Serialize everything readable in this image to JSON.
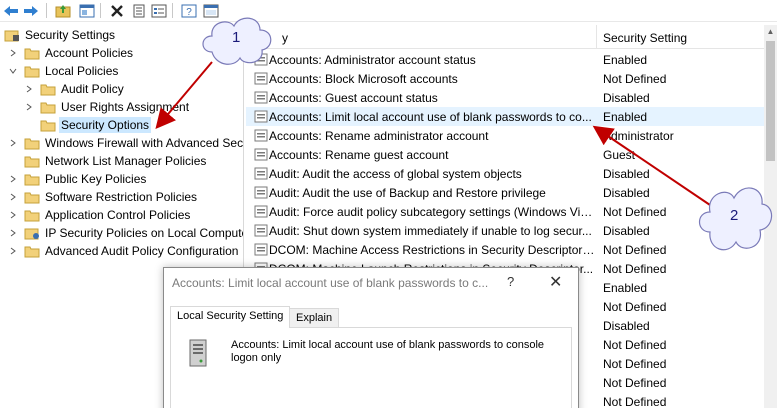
{
  "toolbar": {
    "buttons": [
      "back-icon",
      "forward-icon",
      "folder-up-icon",
      "properties-icon",
      "delete-icon",
      "export-icon",
      "list-icon",
      "help-icon",
      "console-icon"
    ]
  },
  "tree": {
    "root": "Security Settings",
    "items": [
      {
        "label": "Account Policies",
        "level": 1,
        "expanded": false
      },
      {
        "label": "Local Policies",
        "level": 1,
        "expanded": true
      },
      {
        "label": "Audit Policy",
        "level": 2
      },
      {
        "label": "User Rights Assignment",
        "level": 2
      },
      {
        "label": "Security Options",
        "level": 2,
        "selected": true
      },
      {
        "label": "Windows Firewall with Advanced Secu",
        "level": 1
      },
      {
        "label": "Network List Manager Policies",
        "level": 1
      },
      {
        "label": "Public Key Policies",
        "level": 1
      },
      {
        "label": "Software Restriction Policies",
        "level": 1
      },
      {
        "label": "Application Control Policies",
        "level": 1
      },
      {
        "label": "IP Security Policies on Local Compute",
        "level": 1
      },
      {
        "label": "Advanced Audit Policy Configuration",
        "level": 1
      }
    ]
  },
  "list": {
    "col_policy": "y",
    "col_setting": "Security Setting",
    "rows": [
      {
        "policy": "Accounts: Administrator account status",
        "setting": "Enabled"
      },
      {
        "policy": "Accounts: Block Microsoft accounts",
        "setting": "Not Defined"
      },
      {
        "policy": "Accounts: Guest account status",
        "setting": "Disabled"
      },
      {
        "policy": "Accounts: Limit local account use of blank passwords to co...",
        "setting": "Enabled",
        "highlighted": true
      },
      {
        "policy": "Accounts: Rename administrator account",
        "setting": "Administrator"
      },
      {
        "policy": "Accounts: Rename guest account",
        "setting": "Guest"
      },
      {
        "policy": "Audit: Audit the access of global system objects",
        "setting": "Disabled"
      },
      {
        "policy": "Audit: Audit the use of Backup and Restore privilege",
        "setting": "Disabled"
      },
      {
        "policy": "Audit: Force audit policy subcategory settings (Windows Vis...",
        "setting": "Not Defined"
      },
      {
        "policy": "Audit: Shut down system immediately if unable to log secur...",
        "setting": "Disabled"
      },
      {
        "policy": "DCOM: Machine Access Restrictions in Security Descriptor D...",
        "setting": "Not Defined"
      },
      {
        "policy": "DCOM: Machine Launch Restrictions in Security Descriptor...",
        "setting": "Not Defined"
      },
      {
        "policy": "",
        "setting": "Enabled"
      },
      {
        "policy": "",
        "setting": "Not Defined"
      },
      {
        "policy": "",
        "setting": "Disabled"
      },
      {
        "policy": "",
        "setting": "Not Defined"
      },
      {
        "policy": "",
        "setting": "Not Defined"
      },
      {
        "policy": "",
        "setting": "Not Defined"
      },
      {
        "policy": "",
        "setting": "Not Defined"
      }
    ]
  },
  "dialog": {
    "title": "Accounts: Limit local account use of blank passwords to c...",
    "help": "?",
    "close": "✕",
    "tabs": [
      "Local Security Setting",
      "Explain"
    ],
    "description": "Accounts: Limit local account use of blank passwords to console logon only"
  },
  "callouts": [
    "1",
    "2"
  ],
  "colors": {
    "selection": "#cce8ff",
    "row_highlight": "#e5f3ff",
    "arrow": "#c00000",
    "cloud_stroke": "#7a7ab8",
    "cloud_fill": "#eef0ff"
  }
}
